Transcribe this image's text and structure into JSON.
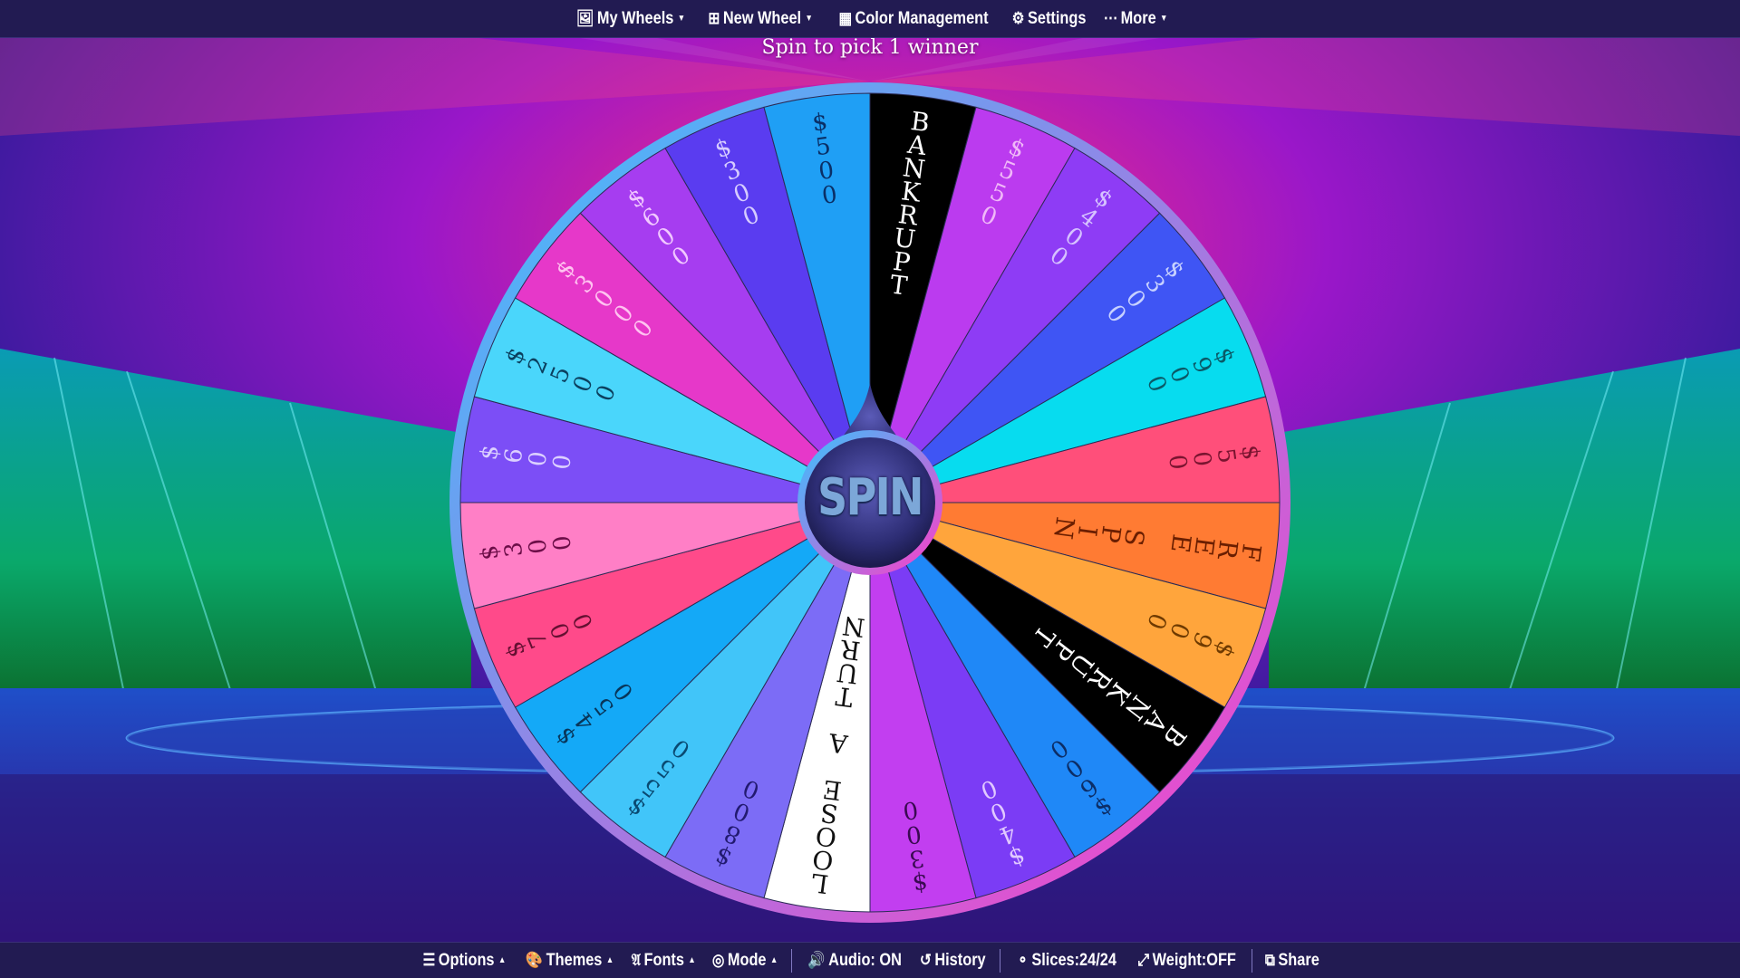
{
  "header": {
    "subtitle": "Spin to pick 1 winner",
    "menu": [
      {
        "label": "My Wheels",
        "icon": "image-icon",
        "dropdown": true
      },
      {
        "label": "New Wheel",
        "icon": "plus-square-icon",
        "dropdown": true
      },
      {
        "label": "Color Management",
        "icon": "grid-icon",
        "dropdown": false
      },
      {
        "label": "Settings",
        "icon": "gear-icon",
        "dropdown": false
      },
      {
        "label": "More",
        "icon": "ellipsis-icon",
        "dropdown": true
      }
    ]
  },
  "wheel": {
    "slice_count": 24,
    "slices": [
      {
        "label": "BANKRUPT",
        "color": "#000000",
        "text_color": "#ffffff"
      },
      {
        "label": "$550",
        "color": "#bb3bef",
        "text_color": "#f0b8f8"
      },
      {
        "label": "$400",
        "color": "#8e3cf5",
        "text_color": "#d6c2ff"
      },
      {
        "label": "$300",
        "color": "#3f55f4",
        "text_color": "#c7d1ff"
      },
      {
        "label": "$900",
        "color": "#07dcef",
        "text_color": "#0a5a68"
      },
      {
        "label": "$500",
        "color": "#ff4f7a",
        "text_color": "#7a1430"
      },
      {
        "label": "FREE SPIN",
        "color": "#ff7b33",
        "text_color": "#6a1e00"
      },
      {
        "label": "$900",
        "color": "#ffa53c",
        "text_color": "#6e3a00"
      },
      {
        "label": "BANKRUPT",
        "color": "#000000",
        "text_color": "#ffffff"
      },
      {
        "label": "$600",
        "color": "#1f88f7",
        "text_color": "#0c2d66"
      },
      {
        "label": "$400",
        "color": "#7b3cf5",
        "text_color": "#e1c9ff"
      },
      {
        "label": "$300",
        "color": "#c23ef0",
        "text_color": "#3a0a52"
      },
      {
        "label": "LOOSE A TURN",
        "color": "#ffffff",
        "text_color": "#111111"
      },
      {
        "label": "$800",
        "color": "#7c6cf6",
        "text_color": "#221a70"
      },
      {
        "label": "$550",
        "color": "#41c5f9",
        "text_color": "#0a4a72"
      },
      {
        "label": "$450",
        "color": "#14a9f7",
        "text_color": "#08365a"
      },
      {
        "label": "$700",
        "color": "#ff4a8a",
        "text_color": "#651032"
      },
      {
        "label": "$300",
        "color": "#ff7fc6",
        "text_color": "#6c0e48"
      },
      {
        "label": "$600",
        "color": "#7c4ef6",
        "text_color": "#dcd0ff"
      },
      {
        "label": "$2500",
        "color": "#4ad6fb",
        "text_color": "#0b3f5e"
      },
      {
        "label": "$3000",
        "color": "#e638c9",
        "text_color": "#ffc2f0"
      },
      {
        "label": "$600",
        "color": "#a63df0",
        "text_color": "#f1c8ff"
      },
      {
        "label": "$300",
        "color": "#5a3cf0",
        "text_color": "#d6ccff"
      },
      {
        "label": "$500",
        "color": "#1f9ff5",
        "text_color": "#0a2f66"
      }
    ]
  },
  "spin_button": {
    "label": "SPIN"
  },
  "footer": {
    "menu": [
      {
        "label": "Options",
        "icon": "sliders-icon",
        "dropdown": true
      },
      {
        "label": "Themes",
        "icon": "palette-icon",
        "dropdown": true
      },
      {
        "label": "Fonts",
        "icon": "font-icon",
        "dropdown": true
      },
      {
        "label": "Mode",
        "icon": "gamepad-icon",
        "dropdown": true
      },
      {
        "label": "Audio: ON",
        "icon": "volume-icon",
        "dropdown": false
      },
      {
        "label": "History",
        "icon": "history-icon",
        "dropdown": false
      },
      {
        "label": "Slices:24/24",
        "icon": "toggle-icon",
        "dropdown": false
      },
      {
        "label": "Weight:OFF",
        "icon": "scale-icon",
        "dropdown": false
      },
      {
        "label": "Share",
        "icon": "share-icon",
        "dropdown": false
      }
    ]
  },
  "colors": {
    "bar_bg": "#221b52",
    "rim_start": "#36c4ff",
    "rim_end": "#ff3cc8",
    "hub": "#3a3a8e"
  }
}
